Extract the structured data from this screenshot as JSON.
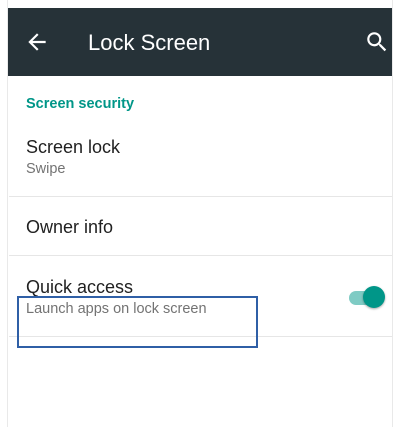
{
  "toolbar": {
    "title": "Lock Screen",
    "back_icon": "arrow-back-icon",
    "search_icon": "search-icon",
    "background_color": "#263238"
  },
  "section": {
    "header": "Screen security",
    "accent_color": "#009688"
  },
  "preferences": [
    {
      "title": "Screen lock",
      "summary": "Swipe"
    },
    {
      "title": "Owner info",
      "summary": ""
    },
    {
      "title": "Quick access",
      "summary": "Launch apps on lock screen",
      "toggle_on": true
    }
  ]
}
